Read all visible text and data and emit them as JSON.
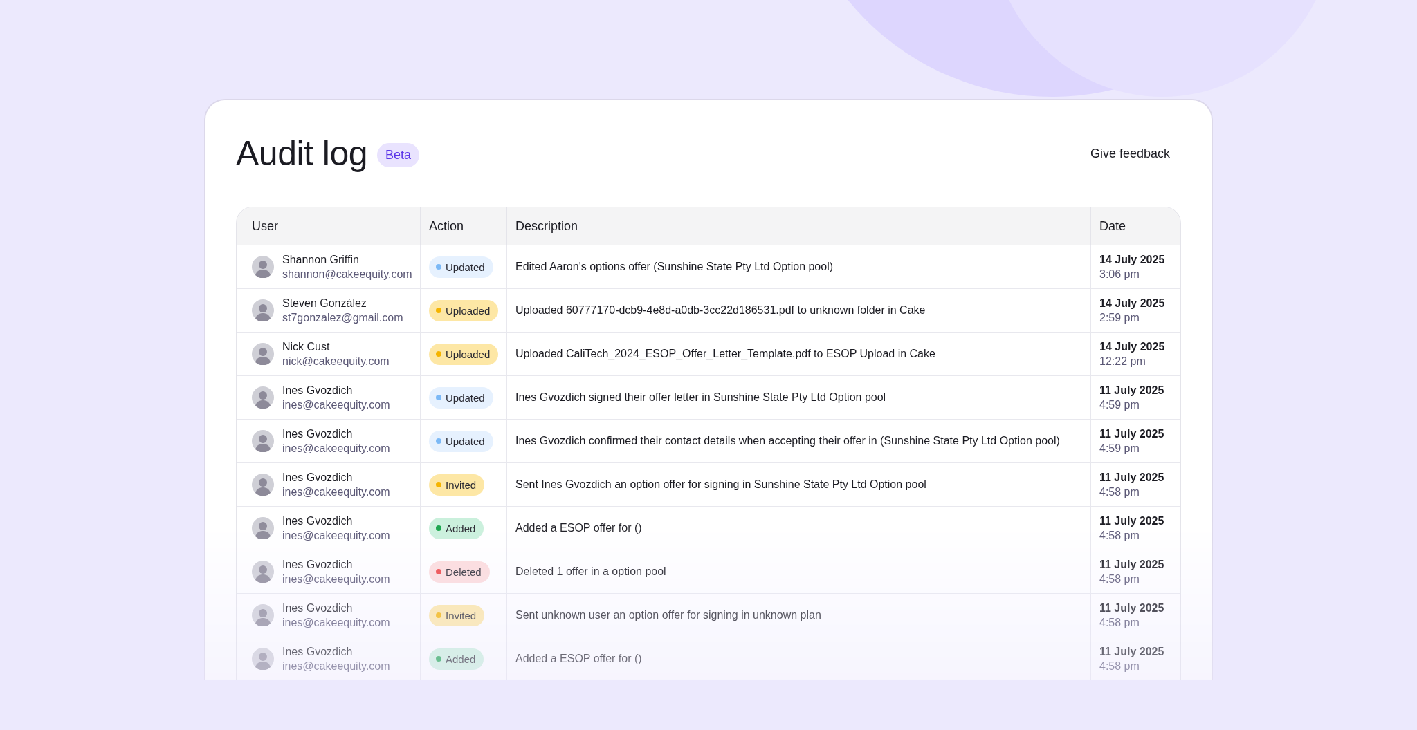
{
  "header": {
    "title": "Audit log",
    "badge": "Beta",
    "feedback_link": "Give feedback"
  },
  "table": {
    "columns": [
      "User",
      "Action",
      "Description",
      "Date"
    ],
    "rows": [
      {
        "user": "Shannon Griffin",
        "email": "shannon@cakeequity.com",
        "action": {
          "label": "Updated",
          "kind": "info"
        },
        "description": "Edited Aaron's options offer (Sunshine State Pty Ltd Option pool)",
        "date": "14 July 2025",
        "time": "3:06 pm"
      },
      {
        "user": "Steven González",
        "email": "st7gonzalez@gmail.com",
        "action": {
          "label": "Uploaded",
          "kind": "warning"
        },
        "description": "Uploaded 60777170-dcb9-4e8d-a0db-3cc22d186531.pdf to unknown folder in Cake",
        "date": "14 July 2025",
        "time": "2:59 pm"
      },
      {
        "user": "Nick Cust",
        "email": "nick@cakeequity.com",
        "action": {
          "label": "Uploaded",
          "kind": "warning"
        },
        "description": "Uploaded CaliTech_2024_ESOP_Offer_Letter_Template.pdf to ESOP Upload in Cake",
        "date": "14 July 2025",
        "time": "12:22 pm"
      },
      {
        "user": "Ines Gvozdich",
        "email": "ines@cakeequity.com",
        "action": {
          "label": "Updated",
          "kind": "info"
        },
        "description": "Ines Gvozdich signed their offer letter in Sunshine State Pty Ltd Option pool",
        "date": "11 July 2025",
        "time": "4:59 pm"
      },
      {
        "user": "Ines Gvozdich",
        "email": "ines@cakeequity.com",
        "action": {
          "label": "Updated",
          "kind": "info"
        },
        "description": "Ines Gvozdich confirmed their contact details when accepting their offer in (Sunshine State Pty Ltd Option pool)",
        "date": "11 July 2025",
        "time": "4:59 pm"
      },
      {
        "user": "Ines Gvozdich",
        "email": "ines@cakeequity.com",
        "action": {
          "label": "Invited",
          "kind": "warning"
        },
        "description": "Sent Ines Gvozdich an option offer for signing in Sunshine State Pty Ltd Option pool",
        "date": "11 July 2025",
        "time": "4:58 pm"
      },
      {
        "user": "Ines Gvozdich",
        "email": "ines@cakeequity.com",
        "action": {
          "label": "Added",
          "kind": "success"
        },
        "description": "Added a ESOP offer for ()",
        "date": "11 July 2025",
        "time": "4:58 pm"
      },
      {
        "user": "Ines Gvozdich",
        "email": "ines@cakeequity.com",
        "action": {
          "label": "Deleted",
          "kind": "danger"
        },
        "description": "Deleted 1 offer in a option pool",
        "date": "11 July 2025",
        "time": "4:58 pm"
      },
      {
        "user": "Ines Gvozdich",
        "email": "ines@cakeequity.com",
        "action": {
          "label": "Invited",
          "kind": "warning"
        },
        "description": "Sent unknown user an option offer for signing in unknown plan",
        "date": "11 July 2025",
        "time": "4:58 pm"
      },
      {
        "user": "Ines Gvozdich",
        "email": "ines@cakeequity.com",
        "action": {
          "label": "Added",
          "kind": "success"
        },
        "description": "Added a ESOP offer for ()",
        "date": "11 July 2025",
        "time": "4:58 pm"
      }
    ]
  }
}
